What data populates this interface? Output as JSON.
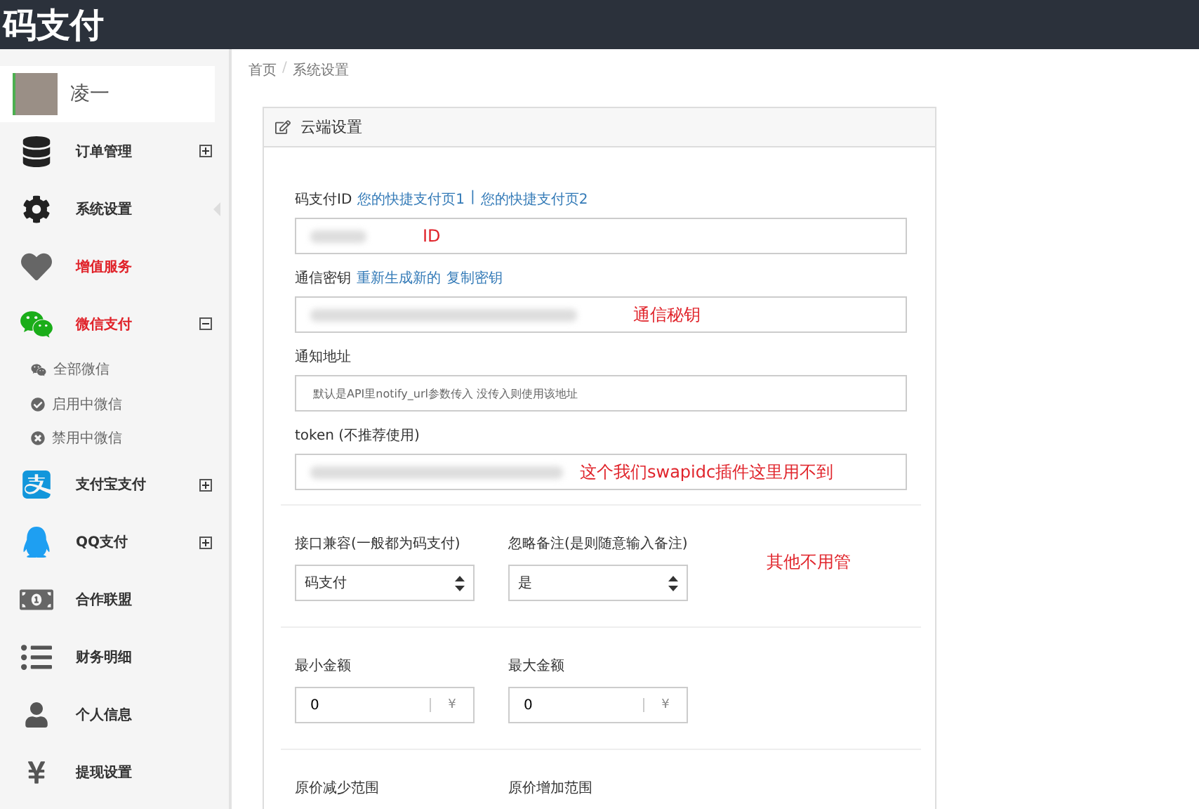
{
  "header": {
    "title": "码支付"
  },
  "user": {
    "name": "凌一"
  },
  "sidebar": {
    "items": [
      {
        "kind": "group",
        "label": "订单管理",
        "highlight": false,
        "expanded": false,
        "selected": false
      },
      {
        "kind": "link",
        "label": "系统设置",
        "highlight": false,
        "selected": true
      },
      {
        "kind": "link",
        "label": "增值服务",
        "highlight": true,
        "selected": false
      },
      {
        "kind": "group",
        "label": "微信支付",
        "highlight": true,
        "expanded": true,
        "selected": false,
        "children": [
          {
            "label": "全部微信"
          },
          {
            "label": "启用中微信"
          },
          {
            "label": "禁用中微信"
          }
        ]
      },
      {
        "kind": "group",
        "label": "支付宝支付",
        "highlight": false,
        "expanded": false,
        "selected": false
      },
      {
        "kind": "group",
        "label": "QQ支付",
        "highlight": false,
        "expanded": false,
        "selected": false
      },
      {
        "kind": "link",
        "label": "合作联盟",
        "highlight": false,
        "selected": false
      },
      {
        "kind": "link",
        "label": "财务明细",
        "highlight": false,
        "selected": false
      },
      {
        "kind": "link",
        "label": "个人信息",
        "highlight": false,
        "selected": false
      },
      {
        "kind": "link",
        "label": "提现设置",
        "highlight": false,
        "selected": false
      }
    ]
  },
  "breadcrumb": {
    "items": [
      "首页",
      "系统设置"
    ],
    "separator": "/"
  },
  "panel": {
    "title": "云端设置",
    "fields": [
      {
        "label": "码支付ID",
        "links": [
          "您的快捷支付页1",
          "您的快捷支付页2"
        ],
        "link_separator": "|",
        "redacted": true,
        "annotation": "ID"
      },
      {
        "label": "通信密钥",
        "links": [
          "重新生成新的",
          "复制密钥"
        ],
        "redacted": true,
        "annotation": "通信秘钥"
      },
      {
        "label": "通知地址",
        "placeholder": "默认是API里notify_url参数传入 没传入则使用该地址"
      },
      {
        "label": "token (不推荐使用)",
        "redacted": true,
        "annotation": "这个我们swapidc插件这里用不到"
      }
    ],
    "selects": [
      {
        "label": "接口兼容(一般都为码支付)",
        "value": "码支付"
      },
      {
        "label": "忽略备注(是则随意输入备注)",
        "value": "是"
      }
    ],
    "selects_note": "其他不用管",
    "amounts": [
      {
        "label": "最小金额",
        "value": "0",
        "unit": "¥"
      },
      {
        "label": "最大金额",
        "value": "0",
        "unit": "¥"
      }
    ],
    "ranges": [
      {
        "label": "原价减少范围"
      },
      {
        "label": "原价增加范围"
      }
    ]
  }
}
